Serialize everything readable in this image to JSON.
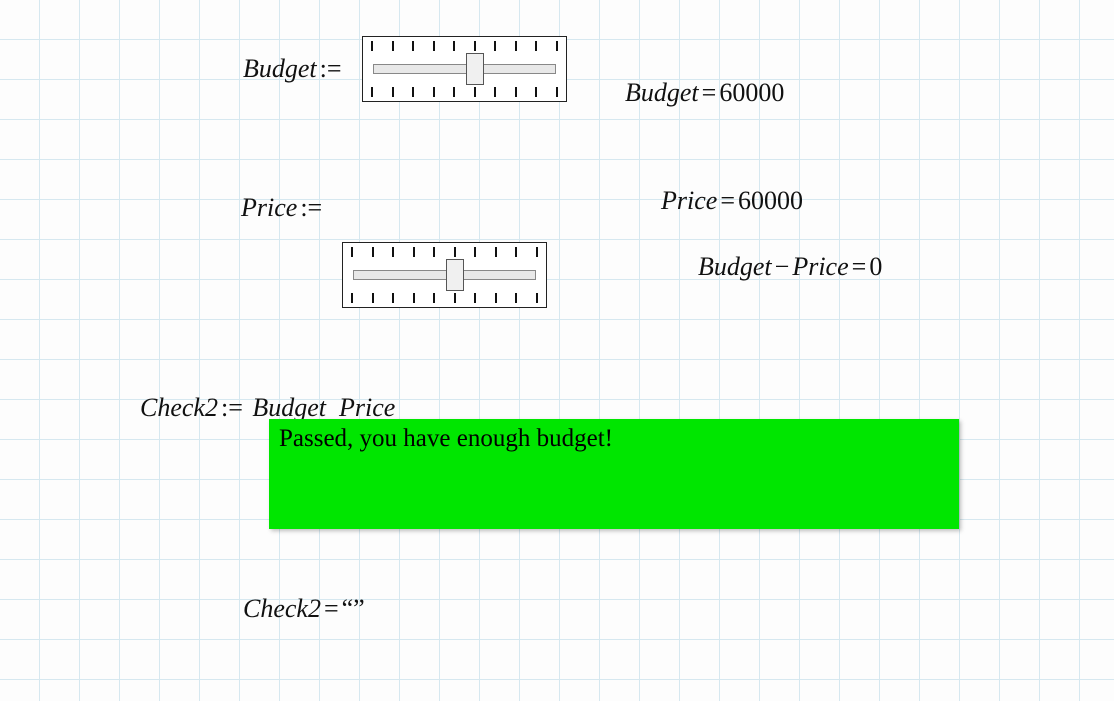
{
  "budget_slider": {
    "label": "Budget",
    "assign_op": ":=",
    "thumb_percent": 55,
    "ticks": 10,
    "value_expr_lhs": "Budget",
    "value_expr_op": "=",
    "value_expr_rhs": "60000"
  },
  "price_slider": {
    "label": "Price",
    "assign_op": ":=",
    "thumb_percent": 55,
    "ticks": 10,
    "value_expr_lhs": "Price",
    "value_expr_op": "=",
    "value_expr_rhs": "60000"
  },
  "diff_expr": {
    "lhs1": "Budget",
    "minus": "−",
    "lhs2": "Price",
    "op": "=",
    "rhs": "0"
  },
  "check_def": {
    "lhs": "Check2",
    "assign_op": ":=",
    "rhs_a": "Budget",
    "rhs_b": "Price"
  },
  "result_message": "Passed, you have enough budget!",
  "check_result": {
    "lhs": "Check2",
    "op": "=",
    "rhs": "“”"
  }
}
